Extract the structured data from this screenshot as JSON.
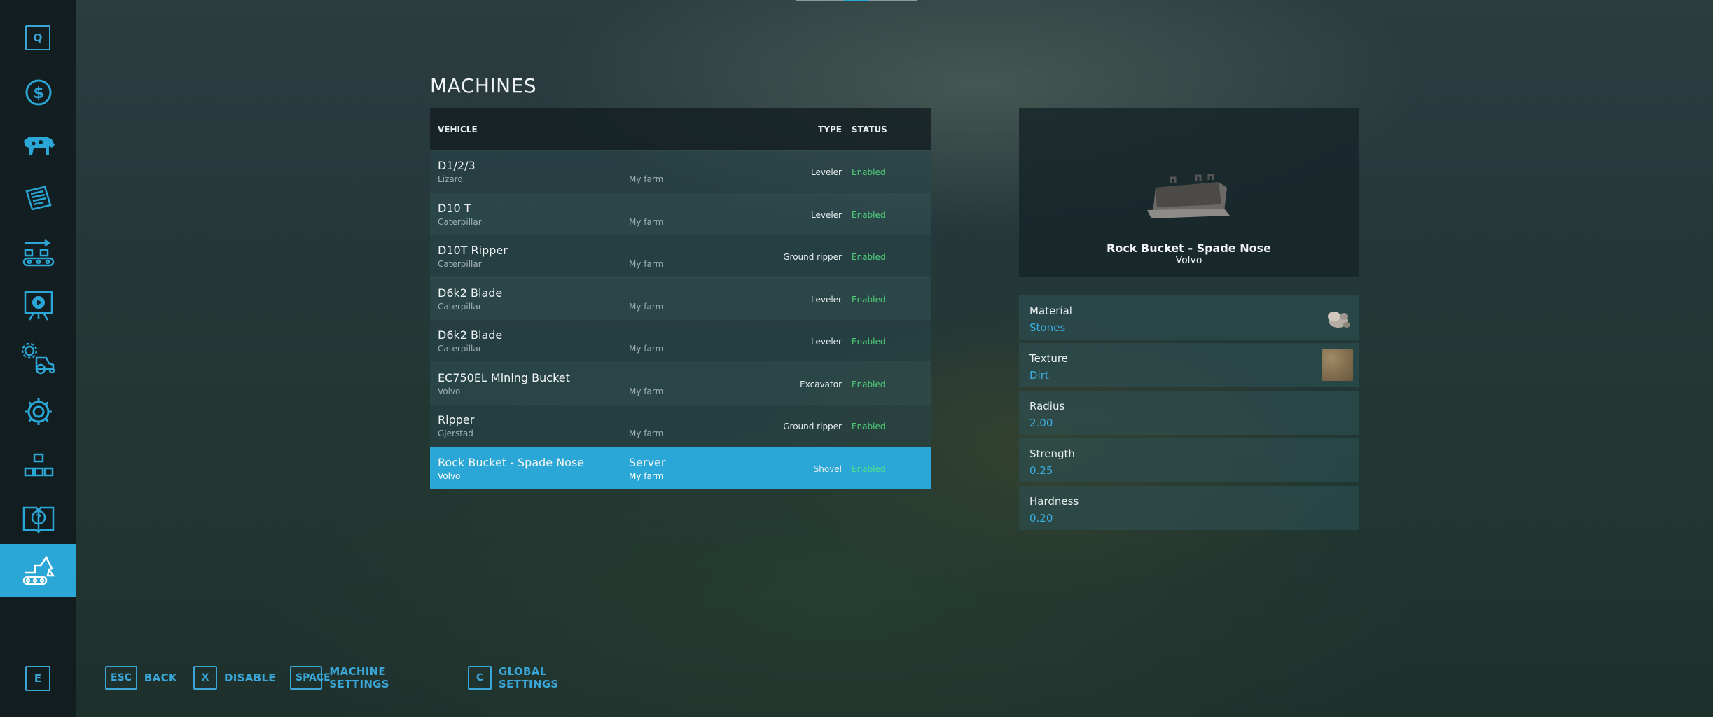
{
  "sidebar": {
    "top_key": "Q",
    "bottom_key": "E",
    "items": [
      {
        "icon": "dollar-icon"
      },
      {
        "icon": "cow-icon"
      },
      {
        "icon": "contracts-icon"
      },
      {
        "icon": "production-icon"
      },
      {
        "icon": "tutorial-board-icon"
      },
      {
        "icon": "vehicle-settings-icon"
      },
      {
        "icon": "gear-icon"
      },
      {
        "icon": "blocks-icon"
      },
      {
        "icon": "help-book-icon"
      },
      {
        "icon": "excavator-icon",
        "active": true
      }
    ],
    "accent": "#2aa7d7"
  },
  "page": {
    "title": "MACHINES"
  },
  "table": {
    "headers": {
      "vehicle": "VEHICLE",
      "type": "TYPE",
      "status": "STATUS"
    },
    "rows": [
      {
        "name": "D1/2/3",
        "brand": "Lizard",
        "owner": "My farm",
        "owner_line1": "",
        "type": "Leveler",
        "status": "Enabled"
      },
      {
        "name": "D10 T",
        "brand": "Caterpillar",
        "owner": "My farm",
        "owner_line1": "",
        "type": "Leveler",
        "status": "Enabled"
      },
      {
        "name": "D10T Ripper",
        "brand": "Caterpillar",
        "owner": "My farm",
        "owner_line1": "",
        "type": "Ground ripper",
        "status": "Enabled"
      },
      {
        "name": "D6k2 Blade",
        "brand": "Caterpillar",
        "owner": "My farm",
        "owner_line1": "",
        "type": "Leveler",
        "status": "Enabled"
      },
      {
        "name": "D6k2 Blade",
        "brand": "Caterpillar",
        "owner": "My farm",
        "owner_line1": "",
        "type": "Leveler",
        "status": "Enabled"
      },
      {
        "name": "EC750EL Mining Bucket",
        "brand": "Volvo",
        "owner": "My farm",
        "owner_line1": "",
        "type": "Excavator",
        "status": "Enabled"
      },
      {
        "name": "Ripper",
        "brand": "Gjerstad",
        "owner": "My farm",
        "owner_line1": "",
        "type": "Ground ripper",
        "status": "Enabled"
      },
      {
        "name": "Rock Bucket - Spade Nose",
        "brand": "Volvo",
        "owner": "My farm",
        "owner_line1": "Server",
        "type": "Shovel",
        "status": "Enabled",
        "selected": true
      }
    ]
  },
  "preview": {
    "name": "Rock Bucket - Spade Nose",
    "brand": "Volvo"
  },
  "properties": [
    {
      "label": "Material",
      "value": "Stones",
      "thumb": "stones-icon"
    },
    {
      "label": "Texture",
      "value": "Dirt",
      "thumb": "dirt-texture"
    },
    {
      "label": "Radius",
      "value": "2.00"
    },
    {
      "label": "Strength",
      "value": "0.25"
    },
    {
      "label": "Hardness",
      "value": "0.20"
    }
  ],
  "footer": {
    "buttons": [
      {
        "key": "ESC",
        "label": "BACK"
      },
      {
        "key": "X",
        "label": "DISABLE"
      },
      {
        "key": "SPACE",
        "label": "MACHINE SETTINGS"
      },
      {
        "key": "C",
        "label": "GLOBAL SETTINGS"
      }
    ]
  },
  "colors": {
    "accent": "#2aa7d7",
    "status_enabled": "#4fcf7a",
    "value_blue": "#39aee0"
  }
}
